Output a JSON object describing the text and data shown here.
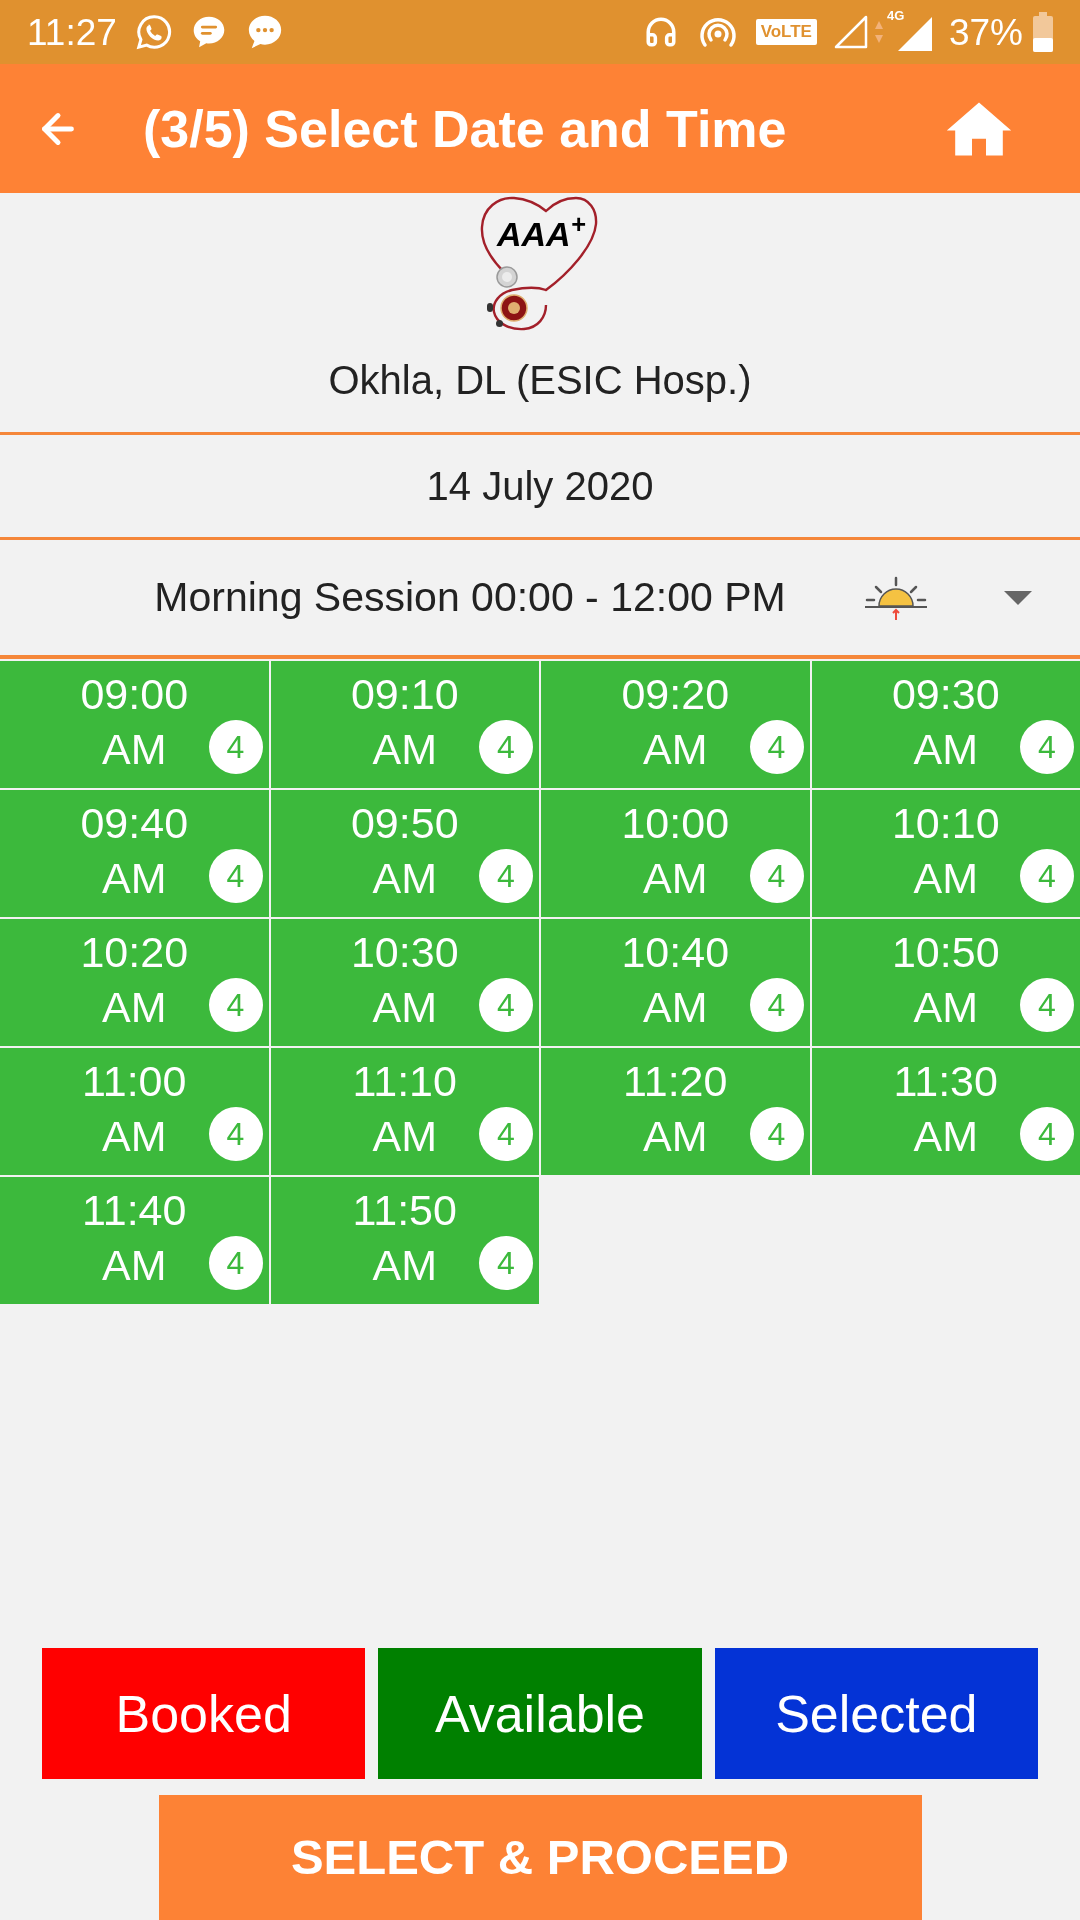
{
  "status_bar": {
    "time": "11:27",
    "network_badge": "VoLTE",
    "network_type": "4G",
    "battery": "37%"
  },
  "header": {
    "title": "(3/5) Select Date and Time"
  },
  "logo": {
    "text": "AAA$^{+}$"
  },
  "location": "Okhla, DL (ESIC Hosp.)",
  "date": "14 July 2020",
  "session": {
    "label": "Morning Session 00:00 - 12:00 PM"
  },
  "slots": [
    {
      "time": "09:00",
      "period": "AM",
      "count": "4",
      "selected": false
    },
    {
      "time": "09:10",
      "period": "AM",
      "count": "4",
      "selected": false
    },
    {
      "time": "09:20",
      "period": "AM",
      "count": "4",
      "selected": false
    },
    {
      "time": "09:30",
      "period": "AM",
      "count": "4",
      "selected": false
    },
    {
      "time": "09:40",
      "period": "AM",
      "count": "4",
      "selected": false
    },
    {
      "time": "09:50",
      "period": "AM",
      "count": "4",
      "selected": false
    },
    {
      "time": "10:00",
      "period": "AM",
      "count": "4",
      "selected": false
    },
    {
      "time": "10:10",
      "period": "AM",
      "count": "4",
      "selected": false
    },
    {
      "time": "10:20",
      "period": "AM",
      "count": "4",
      "selected": false
    },
    {
      "time": "10:30",
      "period": "AM",
      "count": "4",
      "selected": false
    },
    {
      "time": "10:40",
      "period": "AM",
      "count": "4",
      "selected": false
    },
    {
      "time": "10:50",
      "period": "AM",
      "count": "4",
      "selected": false
    },
    {
      "time": "11:00",
      "period": "AM",
      "count": "4",
      "selected": false
    },
    {
      "time": "11:10",
      "period": "AM",
      "count": "4",
      "selected": false
    },
    {
      "time": "11:20",
      "period": "AM",
      "count": "4",
      "selected": false
    },
    {
      "time": "11:30",
      "period": "AM",
      "count": "4",
      "selected": false
    },
    {
      "time": "11:40",
      "period": "AM",
      "count": "4",
      "selected": false
    },
    {
      "time": "11:50",
      "period": "AM",
      "count": "4",
      "selected": false
    }
  ],
  "legend": [
    {
      "label": "Booked",
      "color": "#ff0000"
    },
    {
      "label": "Available",
      "color": "#008000"
    },
    {
      "label": "Selected",
      "color": "#0433d6"
    }
  ],
  "proceed_button": {
    "label": "SELECT & PROCEED"
  }
}
